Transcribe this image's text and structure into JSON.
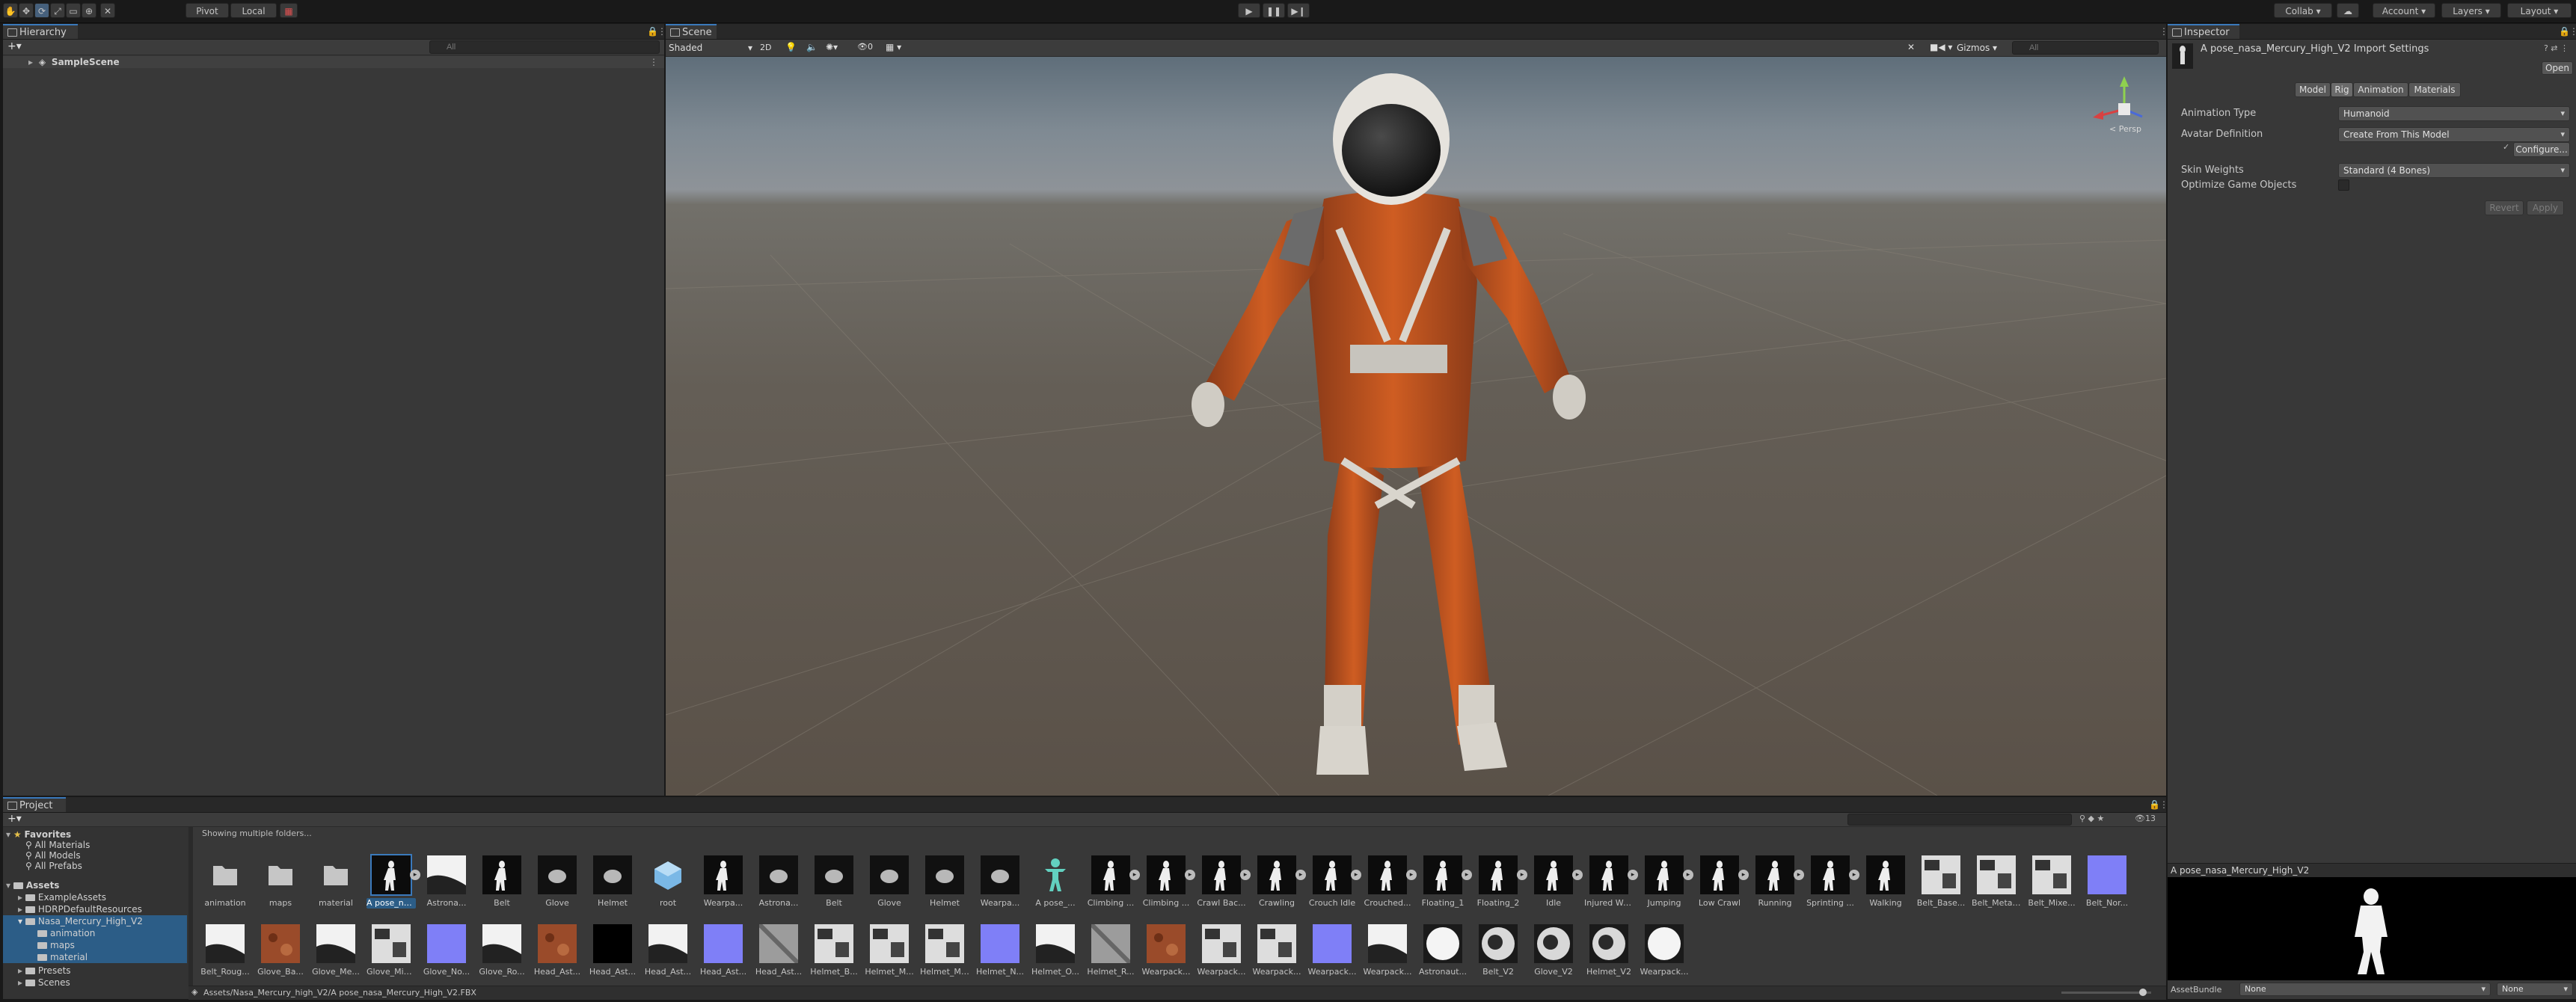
{
  "toolbar": {
    "pivot_label": "Pivot",
    "local_label": "Local",
    "collab_label": "Collab",
    "account_label": "Account",
    "layers_label": "Layers",
    "layout_label": "Layout"
  },
  "hierarchy": {
    "tab_label": "Hierarchy",
    "search_placeholder": "All",
    "scene_name": "SampleScene"
  },
  "scene": {
    "tab_label": "Scene",
    "shading_mode": "Shaded",
    "mode_2d": "2D",
    "fx_count": "0",
    "gizmos_label": "Gizmos",
    "search_placeholder": "All",
    "persp_label": "< Persp"
  },
  "inspector": {
    "tab_label": "Inspector",
    "title": "A pose_nasa_Mercury_High_V2 Import Settings",
    "open_label": "Open",
    "tabs": [
      "Model",
      "Rig",
      "Animation",
      "Materials"
    ],
    "active_tab": "Rig",
    "fields": [
      {
        "label": "Animation Type",
        "value": "Humanoid"
      },
      {
        "label": "Avatar Definition",
        "value": "Create From This Model"
      },
      {
        "label": "Skin Weights",
        "value": "Standard (4 Bones)"
      },
      {
        "label": "Optimize Game Objects",
        "value": ""
      }
    ],
    "configure_label": "Configure...",
    "revert_label": "Revert",
    "apply_label": "Apply",
    "preview_title": "A pose_nasa_Mercury_High_V2",
    "assetbundle_label": "AssetBundle",
    "assetbundle_value": "None",
    "assetbundle_variant": "None"
  },
  "project": {
    "tab_label": "Project",
    "showing_text": "Showing multiple folders...",
    "hidden_count": "13",
    "favorites_label": "Favorites",
    "favorites": [
      "All Materials",
      "All Models",
      "All Prefabs"
    ],
    "assets_label": "Assets",
    "tree": [
      "ExampleAssets",
      "HDRPDefaultResources",
      "Nasa_Mercury_High_V2",
      "animation",
      "maps",
      "material",
      "Presets",
      "Scenes"
    ],
    "path": "Assets/Nasa_Mercury_high_V2/A pose_nasa_Mercury_High_V2.FBX",
    "row1": [
      "animation",
      "maps",
      "material",
      "A pose_na...",
      "Astrona...",
      "Belt",
      "Glove",
      "Helmet",
      "root",
      "Wearpa...",
      "Astrona...",
      "Belt",
      "Glove",
      "Helmet",
      "Wearpa...",
      "A pose_...",
      "Climbing ...",
      "Climbing ...",
      "Crawl Bac...",
      "Crawling",
      "Crouch Idle",
      "Crouched...",
      "Floating_1",
      "Floating_2",
      "Idle",
      "Injured Wa...",
      "Jumping",
      "Low Crawl",
      "Running",
      "Sprinting ...",
      "Walking",
      "Belt_Base...",
      "Belt_Metal...",
      "Belt_Mixe...",
      "Belt_Nor..."
    ],
    "row2": [
      "Belt_Roug...",
      "Glove_Ba...",
      "Glove_Me...",
      "Glove_Mix...",
      "Glove_No...",
      "Glove_Ro...",
      "Head_Ast...",
      "Head_Ast...",
      "Head_Ast...",
      "Head_Ast...",
      "Head_Ast...",
      "Helmet_B...",
      "Helmet_M...",
      "Helmet_Mi...",
      "Helmet_N...",
      "Helmet_O...",
      "Helmet_R...",
      "Wearpack...",
      "Wearpack...",
      "Wearpack...",
      "Wearpack...",
      "Wearpack...",
      "Astronaut...",
      "Belt_V2",
      "Glove_V2",
      "Helmet_V2",
      "Wearpack..."
    ]
  },
  "colors": {
    "accent": "#3a79bb",
    "selection": "#2c5d87",
    "suit_orange": "#c8561f",
    "sky": "#8c9196",
    "ground": "#5f564b"
  }
}
